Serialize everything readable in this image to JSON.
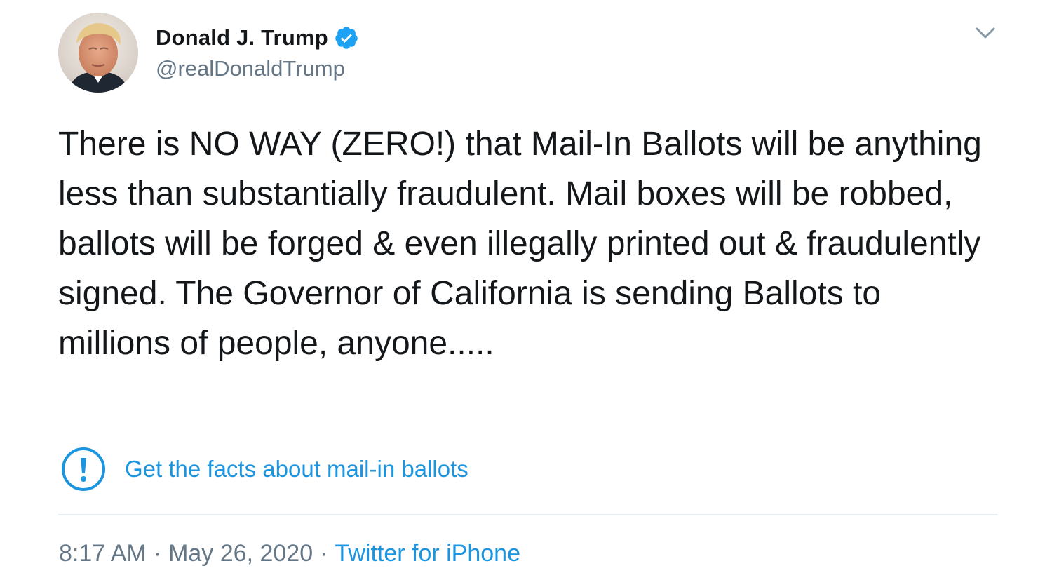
{
  "author": {
    "display_name": "Donald J. Trump",
    "handle": "@realDonaldTrump",
    "verified": true,
    "avatar_icon": "profile-photo"
  },
  "tweet": {
    "text": "There is NO WAY (ZERO!) that Mail-In Ballots will be anything less than substantially fraudulent. Mail boxes will be robbed, ballots will be forged & even illegally printed out & fraudulently signed. The Governor of California is sending Ballots to millions of people, anyone....."
  },
  "notice": {
    "icon": "exclamation-circle-icon",
    "link_text": "Get the facts about mail-in ballots"
  },
  "meta": {
    "time": "8:17 AM",
    "separator": "·",
    "date": "May 26, 2020",
    "source": "Twitter for iPhone"
  },
  "colors": {
    "link_blue": "#1b95e0",
    "verified_blue": "#1da1f2",
    "text": "#14171a",
    "secondary": "#657786",
    "divider": "#e6ecf0"
  }
}
